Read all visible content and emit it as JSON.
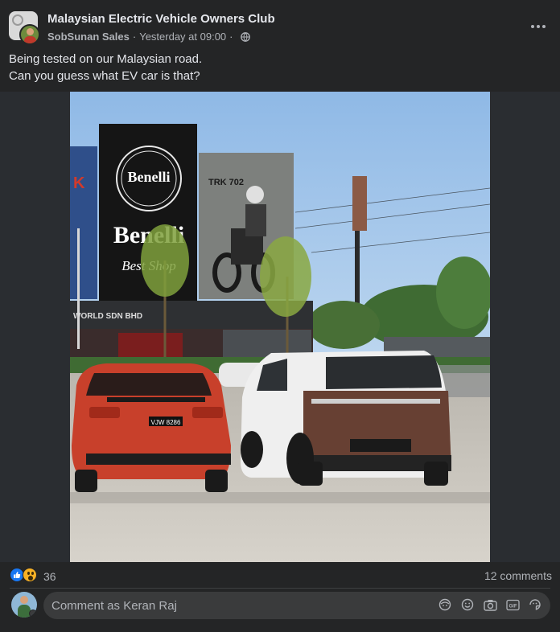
{
  "post": {
    "group_name": "Malaysian Electric Vehicle Owners Club",
    "author": "SobSunan Sales",
    "separator": "·",
    "timestamp": "Yesterday at 09:00",
    "privacy_icon": "globe-icon",
    "text_lines": [
      "Being tested on our Malaysian road.",
      "Can you guess what EV car is that?"
    ]
  },
  "photo": {
    "sign_brand": "Benelli",
    "sign_tagline": "Best Shop",
    "building_text": "WORLD SDN BHD",
    "billboard_model": "TRK 702",
    "plate": "VJW 8286"
  },
  "reactions": {
    "icons": [
      "like-icon",
      "wow-icon"
    ],
    "count": "36",
    "comments": "12 comments"
  },
  "composer": {
    "placeholder": "Comment as Keran Raj",
    "tools": [
      "avatar-sticker-icon",
      "emoji-icon",
      "camera-icon",
      "gif-icon",
      "sticker-icon"
    ]
  },
  "colors": {
    "background": "#242526",
    "text_primary": "#e4e6eb",
    "text_secondary": "#b0b3b8",
    "like_blue": "#1877f2",
    "wow_yellow": "#f7b125",
    "input_bg": "#3a3b3c"
  }
}
